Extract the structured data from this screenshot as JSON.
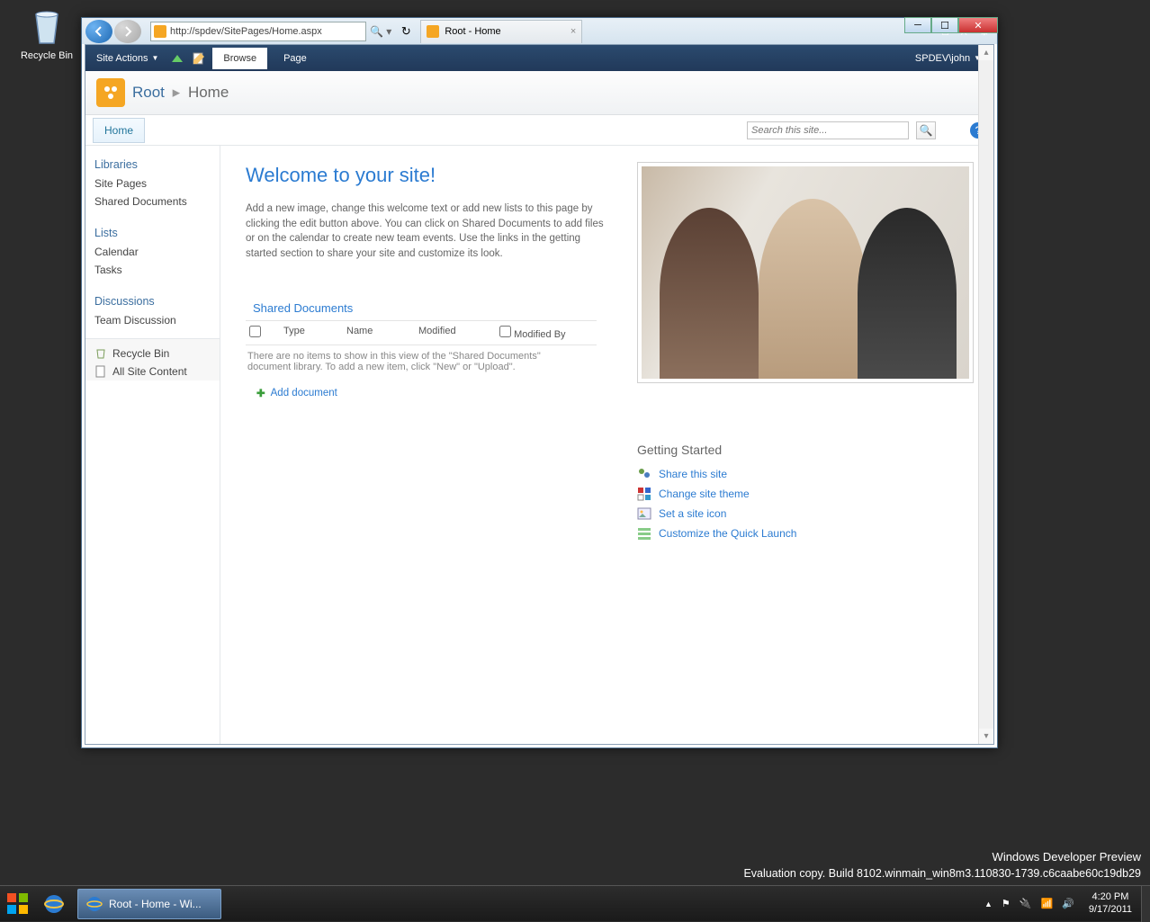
{
  "desktop": {
    "recycle_bin": "Recycle Bin"
  },
  "ie": {
    "url": "http://spdev/SitePages/Home.aspx",
    "tab_title": "Root - Home"
  },
  "ribbon": {
    "site_actions": "Site Actions",
    "browse": "Browse",
    "page": "Page",
    "user": "SPDEV\\john"
  },
  "breadcrumb": {
    "root": "Root",
    "home": "Home"
  },
  "topnav": {
    "home": "Home"
  },
  "search": {
    "placeholder": "Search this site..."
  },
  "leftnav": {
    "libraries": "Libraries",
    "site_pages": "Site Pages",
    "shared_docs": "Shared Documents",
    "lists": "Lists",
    "calendar": "Calendar",
    "tasks": "Tasks",
    "discussions": "Discussions",
    "team_discussion": "Team Discussion",
    "recycle_bin": "Recycle Bin",
    "all_content": "All Site Content"
  },
  "main": {
    "welcome_title": "Welcome to your site!",
    "welcome_body": "Add a new image, change this welcome text or add new lists to this page by clicking the edit button above. You can click on Shared Documents to add files or on the calendar to create new team events. Use the links in the getting started section to share your site and customize its look.",
    "shared_docs_title": "Shared Documents",
    "cols": {
      "type": "Type",
      "name": "Name",
      "modified": "Modified",
      "modified_by": "Modified By"
    },
    "empty_msg": "There are no items to show in this view of the \"Shared Documents\" document library. To add a new item, click \"New\" or \"Upload\".",
    "add_doc": "Add document"
  },
  "getting_started": {
    "title": "Getting Started",
    "share": "Share this site",
    "theme": "Change site theme",
    "icon": "Set a site icon",
    "quick_launch": "Customize the Quick Launch"
  },
  "overlay": {
    "line1": "Windows Developer Preview",
    "line2": "Evaluation copy. Build 8102.winmain_win8m3.110830-1739.c6caabe60c19db29"
  },
  "taskbar": {
    "active": "Root - Home - Wi...",
    "time": "4:20 PM",
    "date": "9/17/2011"
  }
}
